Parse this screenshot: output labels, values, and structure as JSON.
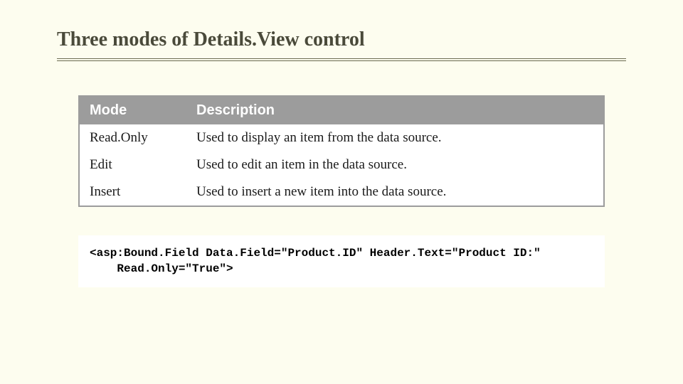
{
  "title": "Three modes of Details.View control",
  "table": {
    "headers": {
      "mode": "Mode",
      "description": "Description"
    },
    "rows": [
      {
        "mode": "Read.Only",
        "description": "Used to display an item from the data source."
      },
      {
        "mode": "Edit",
        "description": "Used to edit an item in the data source."
      },
      {
        "mode": "Insert",
        "description": "Used to insert a new item into the data source."
      }
    ]
  },
  "code": "<asp:Bound.Field Data.Field=\"Product.ID\" Header.Text=\"Product ID:\"\n    Read.Only=\"True\">"
}
